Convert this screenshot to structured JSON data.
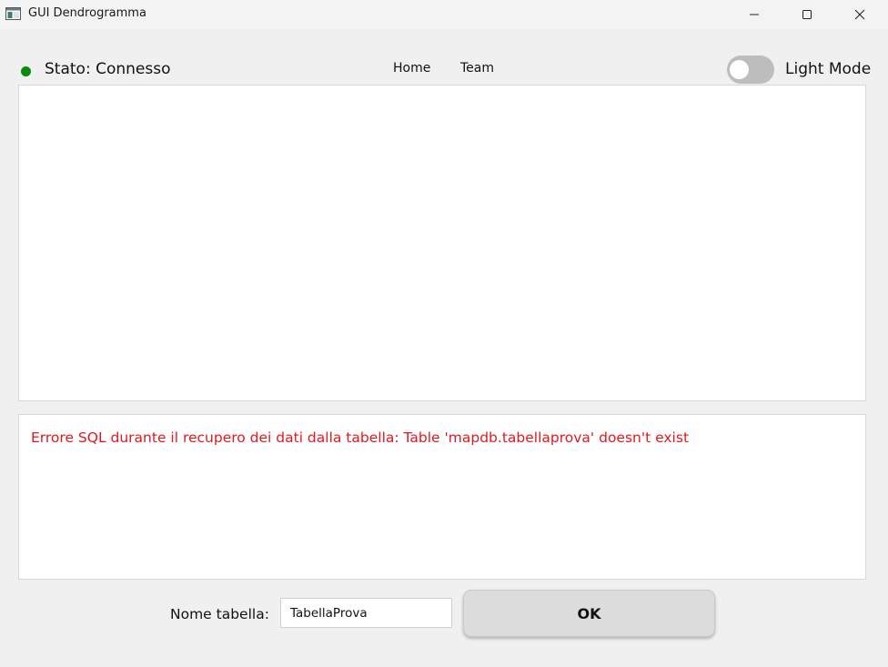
{
  "window": {
    "title": "GUI Dendrogramma",
    "controls": [
      "minimize-icon",
      "maximize-icon",
      "close-icon"
    ]
  },
  "status": {
    "text": "Stato: Connesso",
    "dot_color": "#0a8a0a"
  },
  "nav": {
    "items": [
      {
        "label": "Home"
      },
      {
        "label": "Team"
      }
    ]
  },
  "theme_toggle": {
    "label": "Light Mode",
    "on": false
  },
  "output": {
    "error_message": "Errore SQL durante il recupero dei dati dalla tabella: Table 'mapdb.tabellaprova' doesn't exist",
    "error_color": "#e0191f"
  },
  "form": {
    "table_label": "Nome tabella:",
    "table_value": "TabellaProva",
    "ok_label": "OK"
  }
}
